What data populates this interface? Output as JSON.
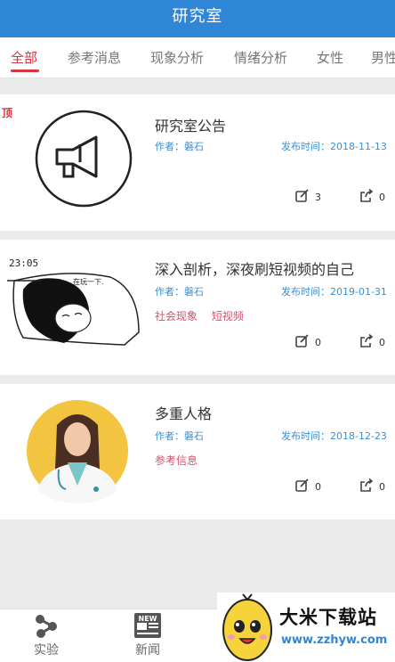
{
  "header": {
    "title": "研究室"
  },
  "tabs": [
    {
      "label": "全部",
      "active": true
    },
    {
      "label": "参考消息"
    },
    {
      "label": "现象分析"
    },
    {
      "label": "情绪分析"
    },
    {
      "label": "女性"
    },
    {
      "label": "男性"
    }
  ],
  "pinned_label": "顶",
  "articles": [
    {
      "title": "研究室公告",
      "author": "作者：磐石",
      "date": "发布时间：2018-11-13",
      "tags": [],
      "edits": "3",
      "shares": "0",
      "thumbnail_icon": "megaphone-icon"
    },
    {
      "title": "深入剖析，深夜刷短视频的自己",
      "author": "作者：磐石",
      "date": "发布时间：2019-01-31",
      "tags": [
        "社会现象",
        "短视频"
      ],
      "edits": "0",
      "shares": "0",
      "thumbnail_text": {
        "clock": "23:05",
        "caption": "在玩一下."
      }
    },
    {
      "title": "多重人格",
      "author": "作者：磐石",
      "date": "发布时间：2018-12-23",
      "tags": [
        "参考信息"
      ],
      "edits": "0",
      "shares": "0",
      "thumbnail_icon": "doctor-illustration"
    }
  ],
  "bottom_nav": [
    {
      "label": "实验",
      "icon": "experiment-icon"
    },
    {
      "label": "新闻",
      "icon": "news-icon",
      "icon_text": "NEW"
    }
  ],
  "watermark": {
    "title": "大米下载站",
    "url": "www.zzhyw.com"
  },
  "colors": {
    "primary": "#2f86d6",
    "accent": "#d9333b",
    "tag": "#d9506a"
  }
}
